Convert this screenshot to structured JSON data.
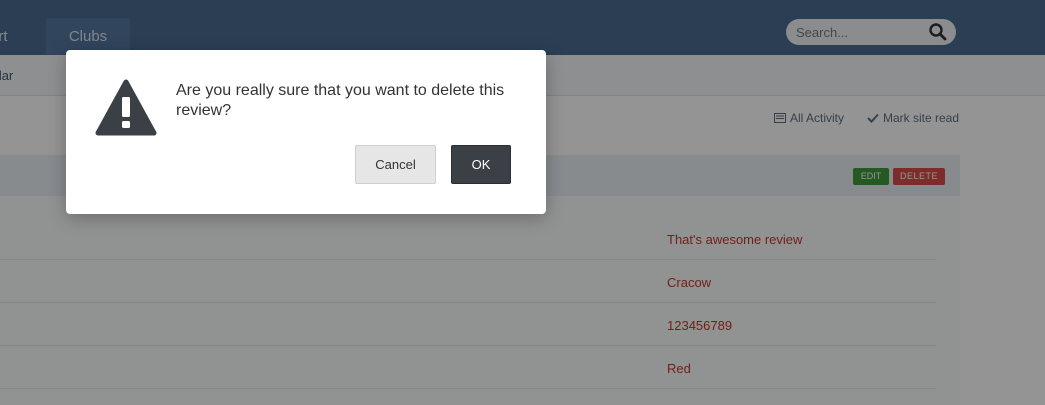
{
  "nav": {
    "tabs": [
      {
        "label": "ort"
      },
      {
        "label": "Clubs"
      }
    ],
    "search_placeholder": "Search...",
    "subnav_item": "endar"
  },
  "links": {
    "all_activity": "All Activity",
    "mark_site_read": "Mark site read"
  },
  "block": {
    "edit_label": "EDIT",
    "delete_label": "DELETE",
    "rows": [
      {
        "value": "That's awesome review"
      },
      {
        "value": "Cracow"
      },
      {
        "value": "123456789"
      },
      {
        "value": "Red"
      }
    ]
  },
  "dialog": {
    "message": "Are you really sure that you want to delete this review?",
    "cancel_label": "Cancel",
    "ok_label": "OK"
  },
  "colors": {
    "topbar": "#4a6c92",
    "accent_red": "#c0392b",
    "ok_button": "#3b3f46"
  }
}
